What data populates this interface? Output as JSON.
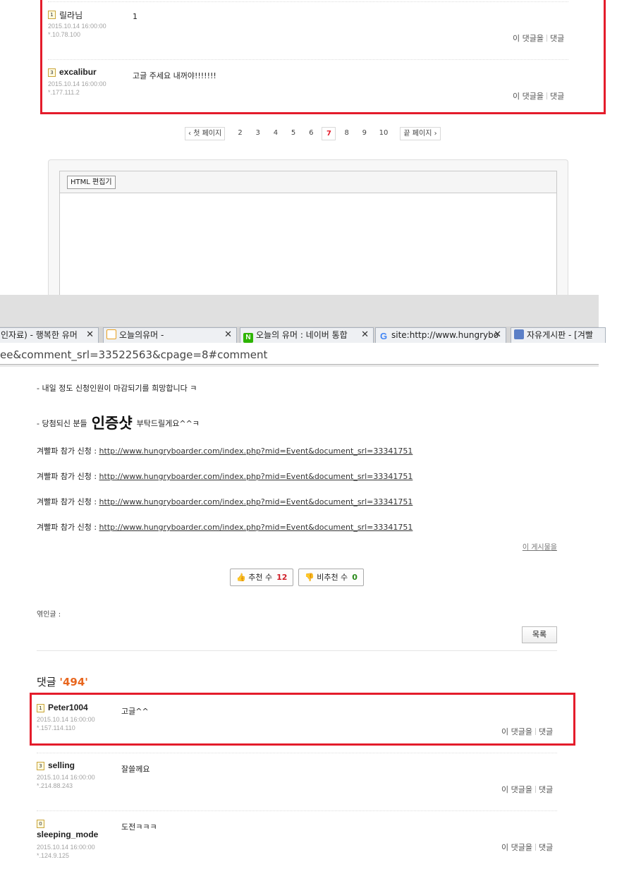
{
  "top_comments": [
    {
      "level": "1",
      "author": "릴라님",
      "date": "2015.10.14 16:00:00",
      "ip": "*.10.78.100",
      "body": "1",
      "reply_this": "이 댓글을",
      "reply": "댓글"
    },
    {
      "level": "3",
      "author": "excalibur",
      "date": "2015.10.14 16:00:00",
      "ip": "*.177.111.2",
      "body": "고글 주세요 내꺼야!!!!!!!",
      "reply_this": "이 댓글을",
      "reply": "댓글"
    }
  ],
  "pagination": {
    "first": "첫 페이지",
    "pages": [
      "2",
      "3",
      "4",
      "5",
      "6",
      "7",
      "8",
      "9",
      "10"
    ],
    "current": "7",
    "last": "끝 페이지"
  },
  "editor": {
    "html_button": "HTML 편집기"
  },
  "browser": {
    "tabs": [
      {
        "label": "인자료) - 행복한 유머",
        "icon": "page-icon",
        "color": "#eef0f3"
      },
      {
        "label": "오늘의유머 -",
        "icon": "ou-logo-icon",
        "color": "#eef0f3"
      },
      {
        "label": "오늘의 유머 : 네이버 통합",
        "icon": "naver-icon",
        "color": "#2db400"
      },
      {
        "label": "site:http://www.hungrybo",
        "icon": "google-icon",
        "color": "#4285f4"
      },
      {
        "label": "자유게시판 - [겨빨",
        "icon": "board-icon",
        "color": "#5b7fc7"
      }
    ],
    "url": "ee&comment_srl=33522563&cpage=8#comment"
  },
  "article": {
    "line1": "- 내일 정도 신청인원이 마감되기를 희망합니다 ㅋ",
    "line2_pre": "- 당첨되신 분들",
    "line2_big": "인증샷",
    "line2_post": "부탁드릴게요^^ㅋ",
    "apply_label": "겨빨파 참가 신청 :",
    "apply_links": [
      "http://www.hungryboarder.com/index.php?mid=Event&document_srl=33341751",
      "http://www.hungryboarder.com/index.php?mid=Event&document_srl=33341751",
      "http://www.hungryboarder.com/index.php?mid=Event&document_srl=33341751",
      "http://www.hungryboarder.com/index.php?mid=Event&document_srl=33341751"
    ],
    "post_link": "이 게시물을",
    "upvote_label": "추천 수",
    "upvote_count": "12",
    "downvote_label": "비추천 수",
    "downvote_count": "0",
    "trackback_label": "엮인글 :",
    "list_button": "목록"
  },
  "comments_header": {
    "label": "댓글",
    "count": "'494'"
  },
  "bottom_comments": [
    {
      "level": "1",
      "author": "Peter1004",
      "date": "2015.10.14 16:00:00",
      "ip": "*.157.114.110",
      "body": "고글^^",
      "reply_this": "이 댓글을",
      "reply": "댓글"
    },
    {
      "level": "3",
      "author": "selling",
      "date": "2015.10.14 16:00:00",
      "ip": "*.214.88.243",
      "body": "잘쓸께요",
      "reply_this": "이 댓글을",
      "reply": "댓글"
    },
    {
      "level": "0",
      "author": "sleeping_mode",
      "date": "2015.10.14 16:00:00",
      "ip": "*.124.9.125",
      "body": "도전ㅋㅋㅋ",
      "reply_this": "이 댓글을",
      "reply": "댓글"
    }
  ],
  "colors": {
    "highlight": "#e41c2b",
    "count": "#e8661e",
    "up": "#d0202a",
    "down": "#2a8a1a"
  }
}
